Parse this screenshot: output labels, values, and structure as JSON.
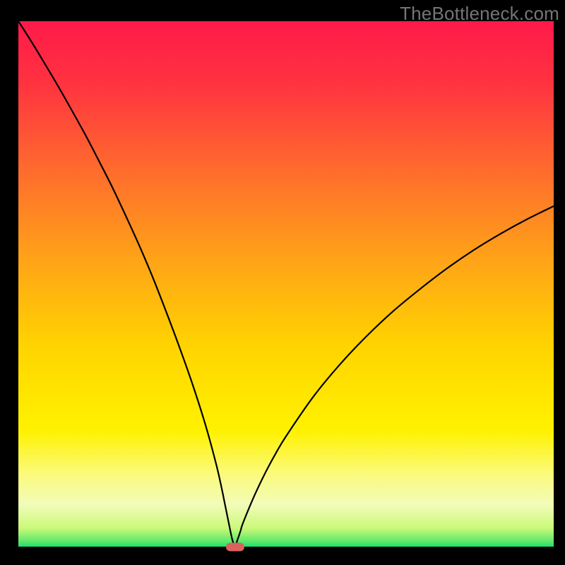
{
  "watermark": "TheBottleneck.com",
  "chart_data": {
    "type": "line",
    "title": "",
    "xlabel": "",
    "ylabel": "",
    "xlim": [
      0,
      100
    ],
    "ylim": [
      0,
      100
    ],
    "x": [
      0,
      2.5,
      5,
      7.5,
      10,
      12.5,
      15,
      17.5,
      20,
      22.5,
      25,
      27.5,
      30,
      32.5,
      35,
      37,
      38,
      38.5,
      39,
      39.5,
      40,
      40.5,
      41,
      41.5,
      42,
      44,
      46,
      48,
      50,
      55,
      60,
      65,
      70,
      75,
      80,
      85,
      90,
      95,
      100
    ],
    "values": [
      100,
      96.0,
      91.8,
      87.5,
      83.0,
      78.4,
      73.5,
      68.5,
      63.1,
      57.5,
      51.5,
      45.0,
      38.2,
      31.0,
      23.0,
      15.5,
      11.0,
      8.5,
      6.0,
      3.5,
      1.2,
      0.2,
      1.5,
      3.0,
      4.6,
      9.5,
      13.8,
      17.6,
      21.0,
      28.4,
      34.6,
      40.0,
      44.8,
      49.0,
      52.9,
      56.4,
      59.5,
      62.3,
      64.8
    ],
    "minimum_marker": {
      "x": 40.5,
      "y": 0.2
    },
    "background_gradient": {
      "stops": [
        {
          "offset": 0.0,
          "color": "#ff1a49"
        },
        {
          "offset": 0.12,
          "color": "#ff3340"
        },
        {
          "offset": 0.28,
          "color": "#ff6a2e"
        },
        {
          "offset": 0.45,
          "color": "#ffa218"
        },
        {
          "offset": 0.62,
          "color": "#ffd400"
        },
        {
          "offset": 0.78,
          "color": "#fff200"
        },
        {
          "offset": 0.86,
          "color": "#fbfa7a"
        },
        {
          "offset": 0.92,
          "color": "#f2fcb8"
        },
        {
          "offset": 0.965,
          "color": "#c9f97a"
        },
        {
          "offset": 0.99,
          "color": "#5de86a"
        },
        {
          "offset": 1.0,
          "color": "#19e36e"
        }
      ]
    }
  },
  "layout": {
    "outer": 800,
    "margin_left": 26,
    "margin_right": 16,
    "margin_top": 30,
    "margin_bottom": 26
  }
}
